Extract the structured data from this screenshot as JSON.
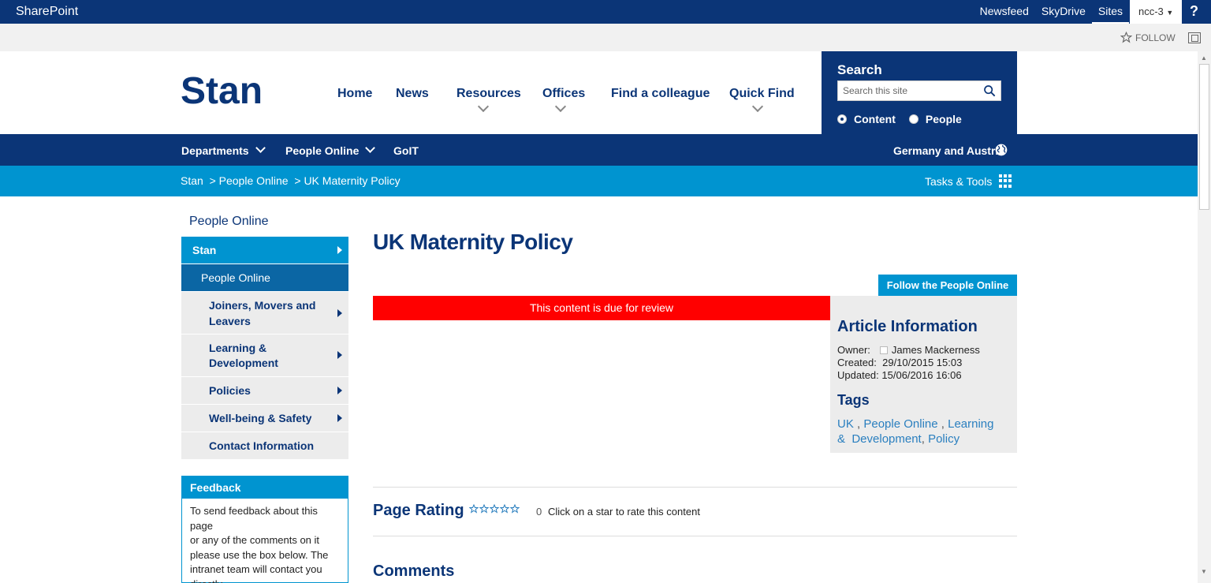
{
  "suite": {
    "brand": "SharePoint",
    "links": [
      "Newsfeed",
      "SkyDrive",
      "Sites"
    ],
    "user": "ncc-3",
    "help": "?"
  },
  "ribbon": {
    "follow": "FOLLOW"
  },
  "header": {
    "logo": "Stan",
    "nav": [
      "Home",
      "News",
      "Resources",
      "Offices",
      "Find a colleague",
      "Quick Find"
    ]
  },
  "search": {
    "title": "Search",
    "placeholder": "Search this site",
    "options": [
      "Content",
      "People"
    ]
  },
  "dept_bar": {
    "items": [
      "Departments",
      "People Online",
      "GoIT"
    ],
    "region": "Germany and Austria"
  },
  "breadcrumb": {
    "text": "Stan  > People Online  > UK Maternity Policy",
    "tools": "Tasks & Tools"
  },
  "left_nav": {
    "title": "People Online",
    "top": "Stan",
    "current": "People Online",
    "sub": [
      {
        "line1": "Joiners, Movers and",
        "line2": "Leavers"
      },
      {
        "line1": "Learning &",
        "line2": "Development"
      },
      {
        "line1": "Policies",
        "line2": ""
      },
      {
        "line1": "Well-being & Safety",
        "line2": ""
      },
      {
        "line1": "Contact Information",
        "line2": ""
      }
    ]
  },
  "feedback": {
    "title": "Feedback",
    "lines": [
      "To send feedback about this page",
      "or any of the comments on it",
      "please use the box below. The",
      "intranet team will contact you",
      "directly"
    ]
  },
  "main": {
    "title": "UK Maternity Policy",
    "follow_site": "Follow the People Online site",
    "review": "This content is due for review"
  },
  "article": {
    "title": "Article Information",
    "owner_label": "Owner:",
    "owner": "James Mackerness",
    "created_label": "Created:",
    "created": "29/10/2015 15:03",
    "updated_label": "Updated:",
    "updated": "15/06/2016 16:06",
    "tags_title": "Tags",
    "tag1": "UK",
    "tag2": "People Online",
    "tag3a": "Learning",
    "tag3b": "&  Development",
    "tag4": "Policy"
  },
  "rating": {
    "title": "Page Rating",
    "count": "0",
    "hint": "Click on a star to rate this content"
  },
  "comments": {
    "title": "Comments"
  },
  "colors": {
    "navy": "#0b3577",
    "blue": "#0094d0",
    "review": "#ff0000"
  }
}
